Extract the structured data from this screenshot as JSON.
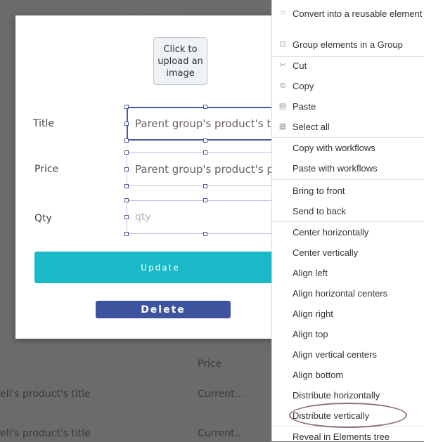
{
  "background": {
    "price_header": "Price",
    "rows": [
      {
        "title": "ell's product's title",
        "price": "Current..."
      },
      {
        "title": "ell's product's title",
        "price": "Current..."
      }
    ]
  },
  "modal": {
    "upload_label": "Click to\nupload an\nimage",
    "title_label": "Title",
    "price_label": "Price",
    "qty_label": "Qty",
    "title_value": "Parent group's product's title",
    "price_value": "Parent group's product's price",
    "qty_placeholder": "qty",
    "update_label": "Update",
    "delete_label": "Delete"
  },
  "menu": {
    "items": [
      {
        "label": "Convert into a reusable element",
        "icon": "star-icon"
      },
      {
        "label": "Group elements in a Group",
        "icon": "group-icon"
      },
      {
        "label": "Cut",
        "icon": "scissors-icon"
      },
      {
        "label": "Copy",
        "icon": "copy-icon"
      },
      {
        "label": "Paste",
        "icon": "paste-icon"
      },
      {
        "label": "Select all",
        "icon": "grid-icon"
      },
      {
        "label": "Copy with workflows"
      },
      {
        "label": "Paste with workflows"
      },
      {
        "label": "Bring to front"
      },
      {
        "label": "Send to back"
      },
      {
        "label": "Center horizontally"
      },
      {
        "label": "Center vertically"
      },
      {
        "label": "Align left"
      },
      {
        "label": "Align horizontal centers"
      },
      {
        "label": "Align right"
      },
      {
        "label": "Align top"
      },
      {
        "label": "Align vertical centers"
      },
      {
        "label": "Align bottom"
      },
      {
        "label": "Distribute horizontally"
      },
      {
        "label": "Distribute vertically",
        "highlighted": true
      },
      {
        "label": "Reveal in Elements tree"
      }
    ]
  },
  "colors": {
    "update_button": "#19b9c7",
    "delete_button": "#3e539d",
    "selection_border": "#4a5a9e",
    "highlight_oval": "#8f6f78"
  }
}
